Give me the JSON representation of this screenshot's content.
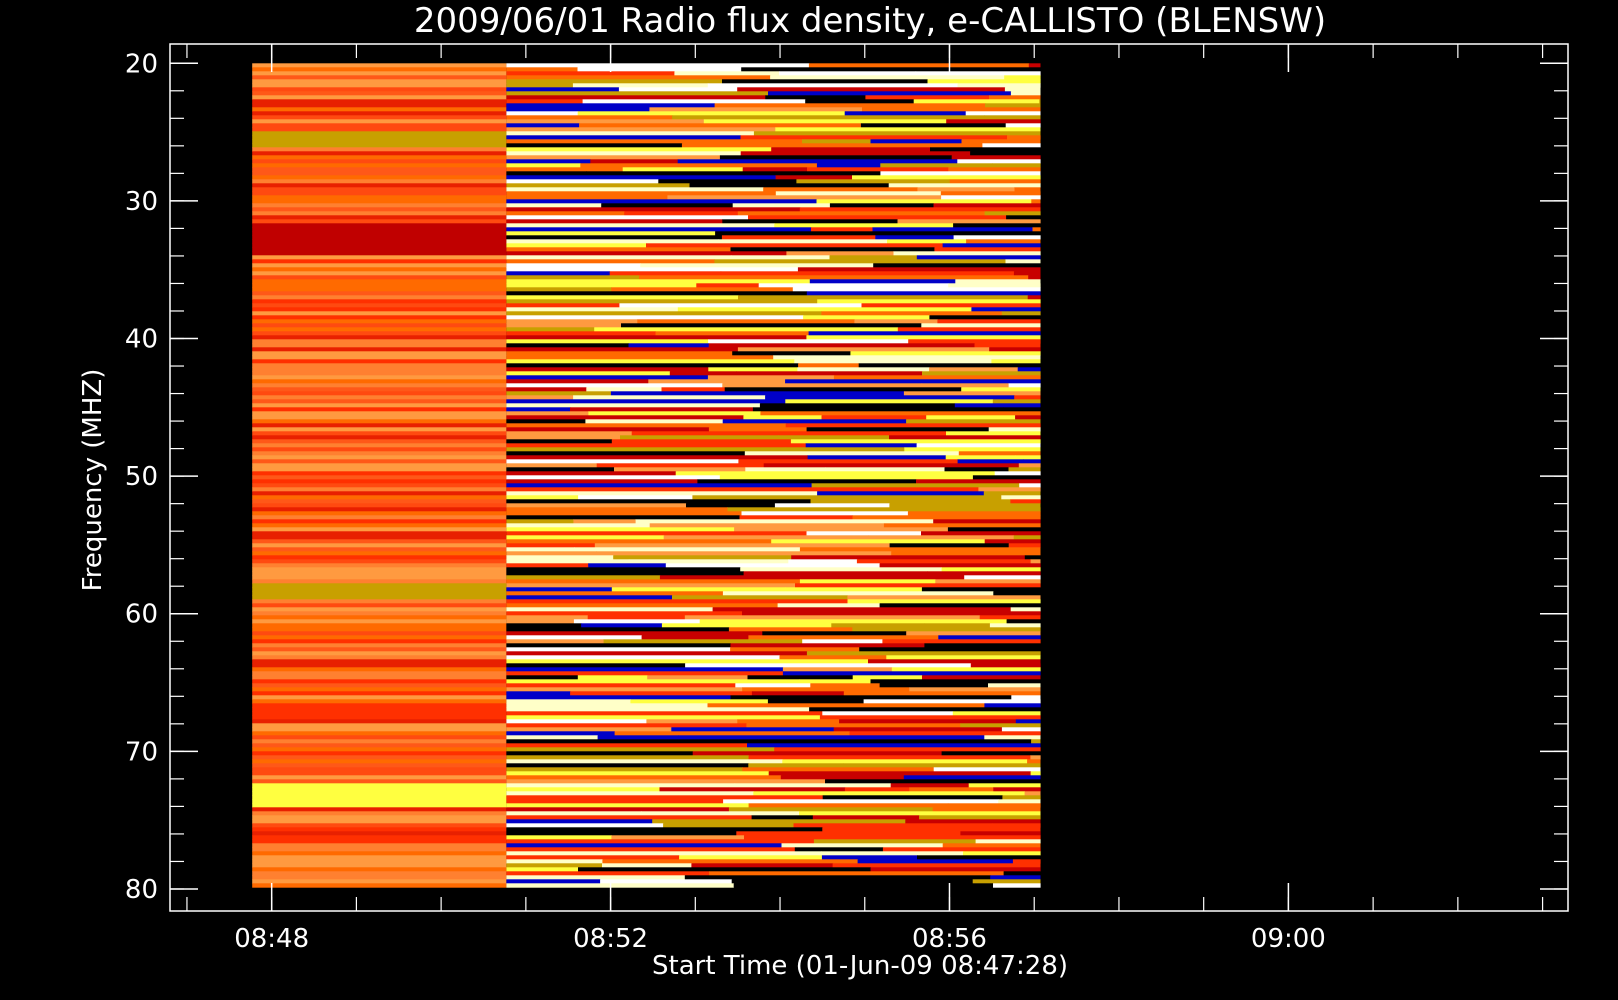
{
  "chart_data": {
    "type": "heatmap",
    "title": "2009/06/01  Radio flux density, e-CALLISTO (BLENSW)",
    "xlabel": "Start Time (01-Jun-09 08:47:28)",
    "ylabel": "Frequency (MHZ)",
    "x_range_minutes_after_0800": [
      46.8,
      63.3
    ],
    "y_range_mhz": [
      18.6,
      81.6
    ],
    "y_inverted": true,
    "x_ticks": [
      {
        "value": 48,
        "label": "08:48"
      },
      {
        "value": 52,
        "label": "08:52"
      },
      {
        "value": 56,
        "label": "08:56"
      },
      {
        "value": 60,
        "label": "09:00"
      }
    ],
    "x_minor_step_minutes": 1,
    "y_ticks": [
      {
        "value": 20,
        "label": "20"
      },
      {
        "value": 30,
        "label": "30"
      },
      {
        "value": 40,
        "label": "40"
      },
      {
        "value": 50,
        "label": "50"
      },
      {
        "value": 60,
        "label": "60"
      },
      {
        "value": 70,
        "label": "70"
      },
      {
        "value": 80,
        "label": "80"
      }
    ],
    "y_minor_step_mhz": 2,
    "data_frequency_mhz": [
      20,
      80
    ],
    "segments": [
      {
        "start_minutes": 47.77,
        "end_minutes": 50.77,
        "style": "quiet"
      },
      {
        "start_minutes": 50.77,
        "end_minutes": 57.07,
        "style": "noisy"
      }
    ],
    "colors": {
      "background": "#000000",
      "axes": "#ffffff",
      "palette": [
        "#000000",
        "#0000c8",
        "#c80000",
        "#ff3000",
        "#ff6a00",
        "#ff9a40",
        "#c8a000",
        "#ffff40",
        "#ffffc8",
        "#ffffff"
      ]
    }
  }
}
